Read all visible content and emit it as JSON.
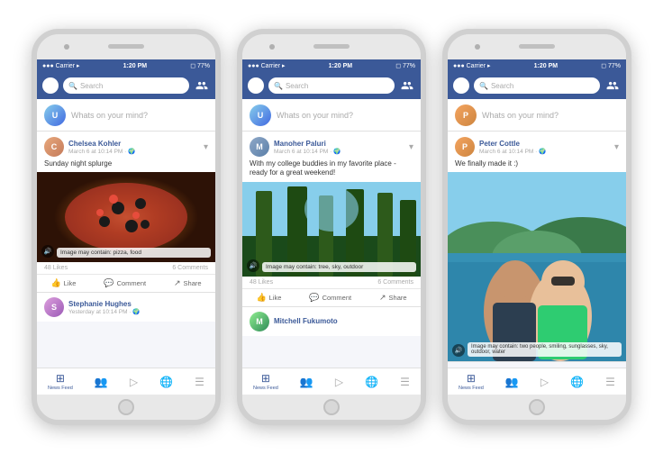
{
  "phones": [
    {
      "id": "phone-1",
      "status": {
        "carrier": "Carrier",
        "signal": "▪▪▪",
        "time": "1:20 PM",
        "battery": "77%"
      },
      "header": {
        "search_placeholder": "Search"
      },
      "story_placeholder": "Whats on your mind?",
      "post": {
        "user_name": "Chelsea Kohler",
        "date": "March 6 at 10:14 PM",
        "text": "Sunday night splurge",
        "image_type": "pizza",
        "image_caption": "Image may contain: pizza, food",
        "likes": "48 Likes",
        "comments": "6 Comments",
        "actions": [
          "Like",
          "Comment",
          "Share"
        ]
      },
      "next_post": {
        "user_name": "Stephanie Hughes",
        "date": "Yesterday at 10:14 PM"
      },
      "nav": [
        "News Feed",
        "",
        "",
        "",
        ""
      ]
    },
    {
      "id": "phone-2",
      "status": {
        "carrier": "Carrier",
        "signal": "▪▪▪",
        "time": "1:20 PM",
        "battery": "77%"
      },
      "header": {
        "search_placeholder": "Search"
      },
      "story_placeholder": "Whats on your mind?",
      "post": {
        "user_name": "Manoher Paluri",
        "date": "March 6 at 10:14 PM",
        "text": "With my college buddies in my favorite place - ready for a great weekend!",
        "image_type": "forest",
        "image_caption": "Image may contain: tree, sky, outdoor",
        "likes": "48 Likes",
        "comments": "6 Comments",
        "actions": [
          "Like",
          "Comment",
          "Share"
        ]
      },
      "next_post": {
        "user_name": "Mitchell Fukumoto",
        "date": ""
      },
      "nav": [
        "News Feed",
        "",
        "",
        "",
        ""
      ]
    },
    {
      "id": "phone-3",
      "status": {
        "carrier": "Carrier",
        "signal": "▪▪▪",
        "time": "1:20 PM",
        "battery": "77%"
      },
      "header": {
        "search_placeholder": "Search"
      },
      "story_placeholder": "Whats on your mind?",
      "post": {
        "user_name": "Peter Cottle",
        "date": "March 6 at 10:14 PM",
        "text": "We finally made it :)",
        "image_type": "selfie",
        "image_caption": "Image may contain: two people, smiling, sunglasses, sky, outdoor, water",
        "likes": "",
        "comments": "",
        "actions": []
      },
      "next_post": null,
      "nav": [
        "News Feed",
        "",
        "",
        "",
        ""
      ]
    }
  ],
  "labels": {
    "like": "Like",
    "comment": "Comment",
    "share": "Share",
    "news_feed": "News Feed"
  }
}
